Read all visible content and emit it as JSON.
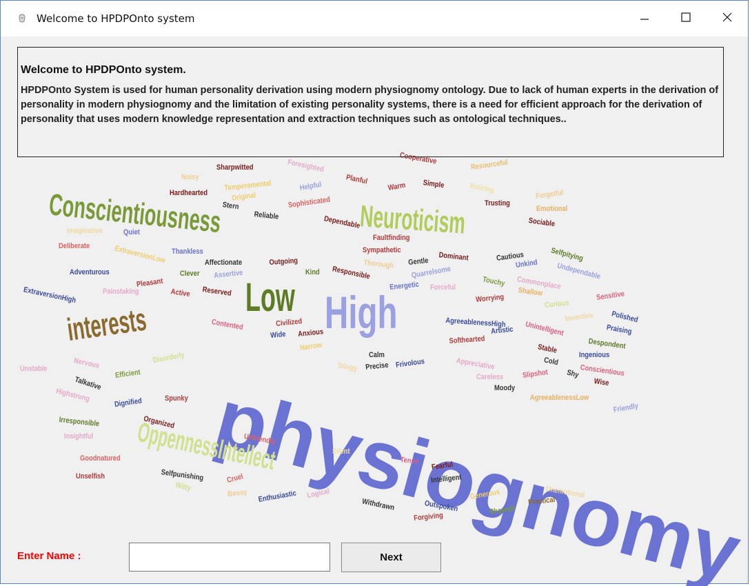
{
  "window": {
    "title": "Welcome to HPDPOnto system"
  },
  "welcome": {
    "heading": "Welcome to HPDPOnto system.",
    "description": "HPDPOnto System is used for human personality derivation using modern physiognomy ontology. Due to lack of human experts in the derivation of personality in modern physiognomy and the limitation of existing personality systems, there is a need for efficient approach for the derivation of personality that uses modern knowledge representation and extraction techniques such as ontological techniques.."
  },
  "word_cloud": [
    {
      "text": "physiognomy",
      "color": "#6a72d2"
    },
    {
      "text": "Conscientiousness",
      "color": "#7a9a3a"
    },
    {
      "text": "Neuroticism",
      "color": "#b2cc5c"
    },
    {
      "text": "High",
      "color": "#9aa0e0"
    },
    {
      "text": "Low",
      "color": "#5e7b26"
    },
    {
      "text": "interests",
      "color": "#8a6a2e"
    },
    {
      "text": "OppennessIntellect",
      "color": "#cfe08f"
    },
    {
      "text": "Sharpwitted",
      "color": "#7a1a1a"
    },
    {
      "text": "Foresighted",
      "color": "#e5a9c9"
    },
    {
      "text": "Cooperative",
      "color": "#b23a3a"
    },
    {
      "text": "Resourceful",
      "color": "#e9bd74"
    },
    {
      "text": "Noisy",
      "color": "#f0cc90"
    },
    {
      "text": "Temperamental",
      "color": "#f0cc6a"
    },
    {
      "text": "Helpful",
      "color": "#9aa0e0"
    },
    {
      "text": "Planful",
      "color": "#b23a3a"
    },
    {
      "text": "Simple",
      "color": "#7a1a1a"
    },
    {
      "text": "Warm",
      "color": "#b23a3a"
    },
    {
      "text": "Retiring",
      "color": "#f0e0a0"
    },
    {
      "text": "Hardhearted",
      "color": "#7a1a1a"
    },
    {
      "text": "Original",
      "color": "#f0cc6a"
    },
    {
      "text": "Sophisticated",
      "color": "#e06060"
    },
    {
      "text": "Forgetful",
      "color": "#f0cc90"
    },
    {
      "text": "Stern",
      "color": "#333333"
    },
    {
      "text": "Trusting",
      "color": "#7a1a1a"
    },
    {
      "text": "Emotional",
      "color": "#e8b060"
    },
    {
      "text": "Reliable",
      "color": "#333333"
    },
    {
      "text": "Dependable",
      "color": "#7a1a1a"
    },
    {
      "text": "Sociable",
      "color": "#7a1a1a"
    },
    {
      "text": "Imaginative",
      "color": "#f0d8a0"
    },
    {
      "text": "Quiet",
      "color": "#6a72d2"
    },
    {
      "text": "Faultfinding",
      "color": "#b23a3a"
    },
    {
      "text": "Deliberate",
      "color": "#e06060"
    },
    {
      "text": "ExtraversionLow",
      "color": "#f0cc6a"
    },
    {
      "text": "Sympathetic",
      "color": "#b23a3a"
    },
    {
      "text": "Thankless",
      "color": "#6a72d2"
    },
    {
      "text": "Dominant",
      "color": "#7a1a1a"
    },
    {
      "text": "Cautious",
      "color": "#333333"
    },
    {
      "text": "Selfpitying",
      "color": "#5e7b26"
    },
    {
      "text": "Affectionate",
      "color": "#333333"
    },
    {
      "text": "Outgoing",
      "color": "#7a1a1a"
    },
    {
      "text": "Thorough",
      "color": "#f0cc90"
    },
    {
      "text": "Gentle",
      "color": "#333333"
    },
    {
      "text": "Unkind",
      "color": "#6a72d2"
    },
    {
      "text": "Undependable",
      "color": "#9aa0e0"
    },
    {
      "text": "Adventurous",
      "color": "#3a4aa0"
    },
    {
      "text": "Clever",
      "color": "#5e7b26"
    },
    {
      "text": "Assertive",
      "color": "#9aa0e0"
    },
    {
      "text": "Kind",
      "color": "#5e7b26"
    },
    {
      "text": "Responsible",
      "color": "#7a1a1a"
    },
    {
      "text": "Quarrelsome",
      "color": "#9aa0e0"
    },
    {
      "text": "Commonplace",
      "color": "#e5a9c9"
    },
    {
      "text": "Pleasant",
      "color": "#b23a3a"
    },
    {
      "text": "Touchy",
      "color": "#7a9a3a"
    },
    {
      "text": "ExtraversionHigh",
      "color": "#3a4aa0"
    },
    {
      "text": "Painstaking",
      "color": "#e5a9c9"
    },
    {
      "text": "Active",
      "color": "#b23a3a"
    },
    {
      "text": "Reserved",
      "color": "#7a1a1a"
    },
    {
      "text": "Energetic",
      "color": "#6a72d2"
    },
    {
      "text": "Forceful",
      "color": "#e5a9c9"
    },
    {
      "text": "Shallow",
      "color": "#e8b060"
    },
    {
      "text": "Worrying",
      "color": "#b23a3a"
    },
    {
      "text": "Curious",
      "color": "#cfe08f"
    },
    {
      "text": "Sensitive",
      "color": "#e06080"
    },
    {
      "text": "Contented",
      "color": "#e06080"
    },
    {
      "text": "Civilized",
      "color": "#b23a3a"
    },
    {
      "text": "Inventive",
      "color": "#f0d8a0"
    },
    {
      "text": "AgreeablenessHigh",
      "color": "#3a4aa0"
    },
    {
      "text": "Artistic",
      "color": "#3a4aa0"
    },
    {
      "text": "Unintelligent",
      "color": "#e06080"
    },
    {
      "text": "Polished",
      "color": "#3a4aa0"
    },
    {
      "text": "Praising",
      "color": "#3a4aa0"
    },
    {
      "text": "Wide",
      "color": "#3a4aa0"
    },
    {
      "text": "Anxious",
      "color": "#7a1a1a"
    },
    {
      "text": "Softhearted",
      "color": "#b23a3a"
    },
    {
      "text": "Despondent",
      "color": "#5e7b26"
    },
    {
      "text": "Stable",
      "color": "#7a1a1a"
    },
    {
      "text": "Narrow",
      "color": "#f0cc6a"
    },
    {
      "text": "Ingenious",
      "color": "#3a4aa0"
    },
    {
      "text": "Unstable",
      "color": "#e5a9c9"
    },
    {
      "text": "Nervous",
      "color": "#e5a9c9"
    },
    {
      "text": "Disorderly",
      "color": "#cfe08f"
    },
    {
      "text": "Calm",
      "color": "#333333"
    },
    {
      "text": "Stingy",
      "color": "#f0d8a0"
    },
    {
      "text": "Precise",
      "color": "#333333"
    },
    {
      "text": "Frivolous",
      "color": "#3a4aa0"
    },
    {
      "text": "Appreciative",
      "color": "#e5a9c9"
    },
    {
      "text": "Cold",
      "color": "#333333"
    },
    {
      "text": "Conscientious",
      "color": "#e06080"
    },
    {
      "text": "Efficient",
      "color": "#7a9a3a"
    },
    {
      "text": "Careless",
      "color": "#e5a9c9"
    },
    {
      "text": "Slipshot",
      "color": "#e06080"
    },
    {
      "text": "Shy",
      "color": "#333333"
    },
    {
      "text": "Wise",
      "color": "#7a1a1a"
    },
    {
      "text": "Talkative",
      "color": "#333333"
    },
    {
      "text": "Highstrung",
      "color": "#e5a9c9"
    },
    {
      "text": "Moody",
      "color": "#333333"
    },
    {
      "text": "AgreeablenessLow",
      "color": "#e8b060"
    },
    {
      "text": "Dignified",
      "color": "#3a4aa0"
    },
    {
      "text": "Spunky",
      "color": "#b23a3a"
    },
    {
      "text": "Friendly",
      "color": "#9aa0e0"
    },
    {
      "text": "Irresponsible",
      "color": "#5e7b26"
    },
    {
      "text": "Organized",
      "color": "#7a1a1a"
    },
    {
      "text": "Insightful",
      "color": "#e5a9c9"
    },
    {
      "text": "Unfriendly",
      "color": "#e06060"
    },
    {
      "text": "Goodnatured",
      "color": "#e06060"
    },
    {
      "text": "Silent",
      "color": "#f0e0a0"
    },
    {
      "text": "Tense",
      "color": "#e06080"
    },
    {
      "text": "Fearful",
      "color": "#7a1a1a"
    },
    {
      "text": "Unselfish",
      "color": "#b23a3a"
    },
    {
      "text": "Selfpunishing",
      "color": "#333333"
    },
    {
      "text": "Intelligent",
      "color": "#333333"
    },
    {
      "text": "Unemotional",
      "color": "#f0d8a0"
    },
    {
      "text": "Cruel",
      "color": "#e06060"
    },
    {
      "text": "Witty",
      "color": "#cfe08f"
    },
    {
      "text": "Bossy",
      "color": "#f0cc90"
    },
    {
      "text": "Enthusiastic",
      "color": "#3a4aa0"
    },
    {
      "text": "Logical",
      "color": "#e5a9c9"
    },
    {
      "text": "Generous",
      "color": "#f0cc6a"
    },
    {
      "text": "Practical",
      "color": "#8a6a2e"
    },
    {
      "text": "Withdrawn",
      "color": "#333333"
    },
    {
      "text": "Outspoken",
      "color": "#3a4aa0"
    },
    {
      "text": "Showoff",
      "color": "#7a9a3a"
    },
    {
      "text": "Forgiving",
      "color": "#b23a3a"
    }
  ],
  "form": {
    "name_label": "Enter Name :",
    "name_value": "",
    "next_label": "Next"
  }
}
